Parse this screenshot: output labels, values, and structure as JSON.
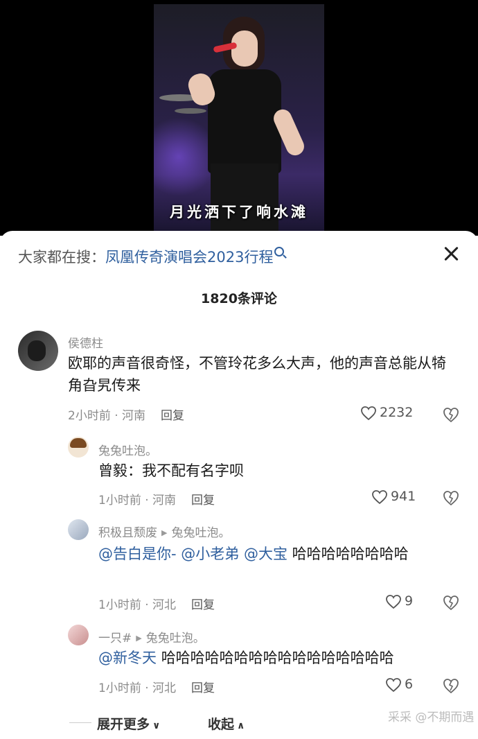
{
  "video": {
    "subtitle": "月光洒下了响水滩"
  },
  "header": {
    "search_prefix": "大家都在搜：",
    "search_term": "凤凰传奇演唱会2023行程",
    "comment_count": "1820条评论"
  },
  "comments": [
    {
      "user": "侯德柱",
      "text": "欧耶的声音很奇怪，不管玲花多么大声，他的声音总能从犄角旮旯传来",
      "time_location": "2小时前 · 河南",
      "reply_label": "回复",
      "likes": "2232"
    },
    {
      "user": "兔兔吐泡。",
      "text": "曾毅：我不配有名字呗",
      "time_location": "1小时前 · 河南",
      "reply_label": "回复",
      "likes": "941"
    },
    {
      "user": "积极且颓废",
      "reply_to": "兔兔吐泡。",
      "mentions": [
        "@告白是你-",
        "@小老弟",
        "@大宝"
      ],
      "text": "哈哈哈哈哈哈哈哈",
      "time_location": "1小时前 · 河北",
      "reply_label": "回复",
      "likes": "9"
    },
    {
      "user": "一只#",
      "reply_to": "兔兔吐泡。",
      "mentions": [
        "@新冬天"
      ],
      "text": "哈哈哈哈哈哈哈哈哈哈哈哈哈哈哈哈",
      "time_location": "1小时前 · 河北",
      "reply_label": "回复",
      "likes": "6"
    }
  ],
  "footer": {
    "expand_label": "展开更多",
    "collapse_label": "收起",
    "watermark": "采采 @不期而遇"
  },
  "colors": {
    "accent_link": "#2f5f9e",
    "meta_gray": "#8a8a8a"
  }
}
